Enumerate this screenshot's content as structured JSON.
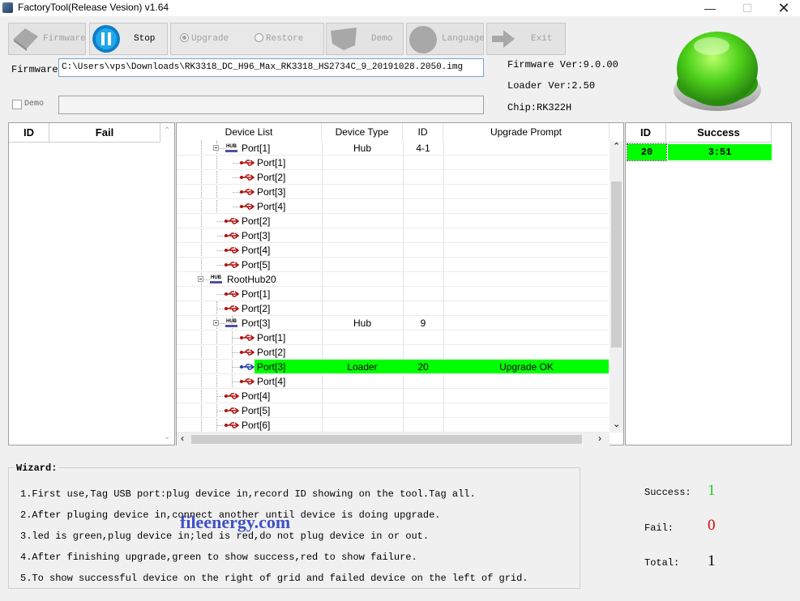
{
  "window": {
    "title": "FactoryTool(Release Vesion) v1.64"
  },
  "toolbar": {
    "firmware": "Firmware",
    "stop": "Stop",
    "upgrade": "Upgrade",
    "restore": "Restore",
    "demo": "Demo",
    "language": "Language",
    "exit": "Exit"
  },
  "firmware_field": {
    "label": "Firmware",
    "path": "C:\\Users\\vps\\Downloads\\RK3318_DC_H96_Max_RK3318_HS2734C_9_20191028.2050.img"
  },
  "demo_field": {
    "label": "Demo",
    "value": ""
  },
  "info": {
    "firmware_ver": "Firmware Ver:9.0.00",
    "loader_ver": "Loader Ver:2.50",
    "chip": "Chip:RK322H"
  },
  "fail_grid": {
    "col_id": "ID",
    "col_fail": "Fail"
  },
  "device_grid": {
    "columns": [
      "Device List",
      "Device Type",
      "ID",
      "Upgrade Prompt"
    ],
    "rows": [
      {
        "name": "Port[1]",
        "type": "Hub",
        "id": "4-1",
        "prompt": ""
      },
      {
        "name": "Port[1]",
        "type": "",
        "id": "",
        "prompt": ""
      },
      {
        "name": "Port[2]",
        "type": "",
        "id": "",
        "prompt": ""
      },
      {
        "name": "Port[3]",
        "type": "",
        "id": "",
        "prompt": ""
      },
      {
        "name": "Port[4]",
        "type": "",
        "id": "",
        "prompt": ""
      },
      {
        "name": "Port[2]",
        "type": "",
        "id": "",
        "prompt": ""
      },
      {
        "name": "Port[3]",
        "type": "",
        "id": "",
        "prompt": ""
      },
      {
        "name": "Port[4]",
        "type": "",
        "id": "",
        "prompt": ""
      },
      {
        "name": "Port[5]",
        "type": "",
        "id": "",
        "prompt": ""
      },
      {
        "name": "RootHub20",
        "type": "",
        "id": "",
        "prompt": ""
      },
      {
        "name": "Port[1]",
        "type": "",
        "id": "",
        "prompt": ""
      },
      {
        "name": "Port[2]",
        "type": "",
        "id": "",
        "prompt": ""
      },
      {
        "name": "Port[3]",
        "type": "Hub",
        "id": "9",
        "prompt": ""
      },
      {
        "name": "Port[1]",
        "type": "",
        "id": "",
        "prompt": ""
      },
      {
        "name": "Port[2]",
        "type": "",
        "id": "",
        "prompt": ""
      },
      {
        "name": "Port[3]",
        "type": "Loader",
        "id": "20",
        "prompt": "Upgrade OK"
      },
      {
        "name": "Port[4]",
        "type": "",
        "id": "",
        "prompt": ""
      },
      {
        "name": "Port[4]",
        "type": "",
        "id": "",
        "prompt": ""
      },
      {
        "name": "Port[5]",
        "type": "",
        "id": "",
        "prompt": ""
      },
      {
        "name": "Port[6]",
        "type": "",
        "id": "",
        "prompt": ""
      }
    ]
  },
  "success_grid": {
    "col_id": "ID",
    "col_success": "Success",
    "rows": [
      {
        "id": "20",
        "time": "3:51"
      }
    ]
  },
  "wizard": {
    "title": "Wizard:",
    "lines": [
      "1.First use,Tag USB port:plug device in,record ID showing on the tool.Tag all.",
      "2.After pluging device in,connect another until device is doing upgrade.",
      "3.led is green,plug device in;led is red,do not plug device in or out.",
      "4.After finishing upgrade,green to show success,red to show failure.",
      "5.To show successful device on the right of grid and failed device on the left of grid."
    ]
  },
  "watermark": "fileenergy.com",
  "stats": {
    "success_label": "Success:",
    "success_value": "1",
    "fail_label": "Fail:",
    "fail_value": "0",
    "total_label": "Total:",
    "total_value": "1"
  },
  "colors": {
    "success_green": "#00ff00",
    "fail_red": "#e00000",
    "success_text": "#22cc22"
  },
  "icons": {
    "status": "green-led-icon",
    "usb": "usb-icon",
    "hub": "hub-icon"
  }
}
